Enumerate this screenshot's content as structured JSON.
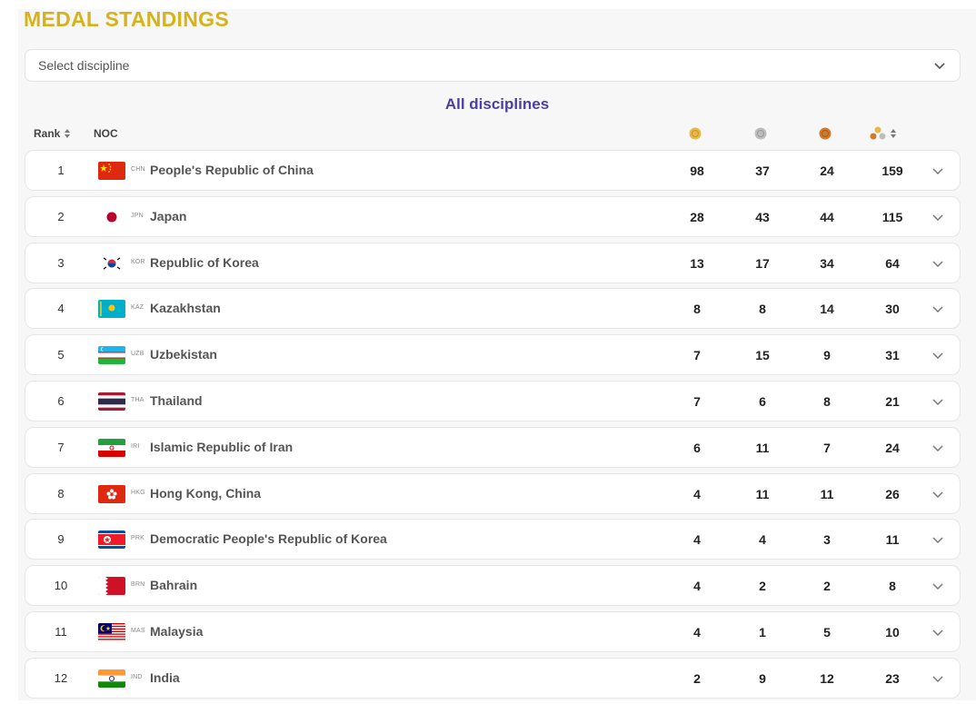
{
  "page": {
    "title": "MEDAL STANDINGS",
    "discipline_select": {
      "placeholder": "Select discipline"
    },
    "subtitle": "All disciplines"
  },
  "table": {
    "headers": {
      "rank": "Rank",
      "noc": "NOC",
      "gold_icon": "gold-medal-icon",
      "silver_icon": "silver-medal-icon",
      "bronze_icon": "bronze-medal-icon",
      "total_icon": "total-medals-icon"
    },
    "rows": [
      {
        "rank": "1",
        "code": "CHN",
        "name": "People's Republic of China",
        "gold": "98",
        "silver": "37",
        "bronze": "24",
        "total": "159"
      },
      {
        "rank": "2",
        "code": "JPN",
        "name": "Japan",
        "gold": "28",
        "silver": "43",
        "bronze": "44",
        "total": "115"
      },
      {
        "rank": "3",
        "code": "KOR",
        "name": "Republic of Korea",
        "gold": "13",
        "silver": "17",
        "bronze": "34",
        "total": "64"
      },
      {
        "rank": "4",
        "code": "KAZ",
        "name": "Kazakhstan",
        "gold": "8",
        "silver": "8",
        "bronze": "14",
        "total": "30"
      },
      {
        "rank": "5",
        "code": "UZB",
        "name": "Uzbekistan",
        "gold": "7",
        "silver": "15",
        "bronze": "9",
        "total": "31"
      },
      {
        "rank": "6",
        "code": "THA",
        "name": "Thailand",
        "gold": "7",
        "silver": "6",
        "bronze": "8",
        "total": "21"
      },
      {
        "rank": "7",
        "code": "IRI",
        "name": "Islamic Republic of Iran",
        "gold": "6",
        "silver": "11",
        "bronze": "7",
        "total": "24"
      },
      {
        "rank": "8",
        "code": "HKG",
        "name": "Hong Kong, China",
        "gold": "4",
        "silver": "11",
        "bronze": "11",
        "total": "26"
      },
      {
        "rank": "9",
        "code": "PRK",
        "name": "Democratic People's Republic of Korea",
        "gold": "4",
        "silver": "4",
        "bronze": "3",
        "total": "11"
      },
      {
        "rank": "10",
        "code": "BRN",
        "name": "Bahrain",
        "gold": "4",
        "silver": "2",
        "bronze": "2",
        "total": "8"
      },
      {
        "rank": "11",
        "code": "MAS",
        "name": "Malaysia",
        "gold": "4",
        "silver": "1",
        "bronze": "5",
        "total": "10"
      },
      {
        "rank": "12",
        "code": "IND",
        "name": "India",
        "gold": "2",
        "silver": "9",
        "bronze": "12",
        "total": "23"
      }
    ]
  },
  "colors": {
    "title": "#d6b21b",
    "subtitle": "#4b3fa5",
    "gold": "#e8b84a",
    "silver": "#b8b8b8",
    "bronze": "#d07a2c"
  }
}
